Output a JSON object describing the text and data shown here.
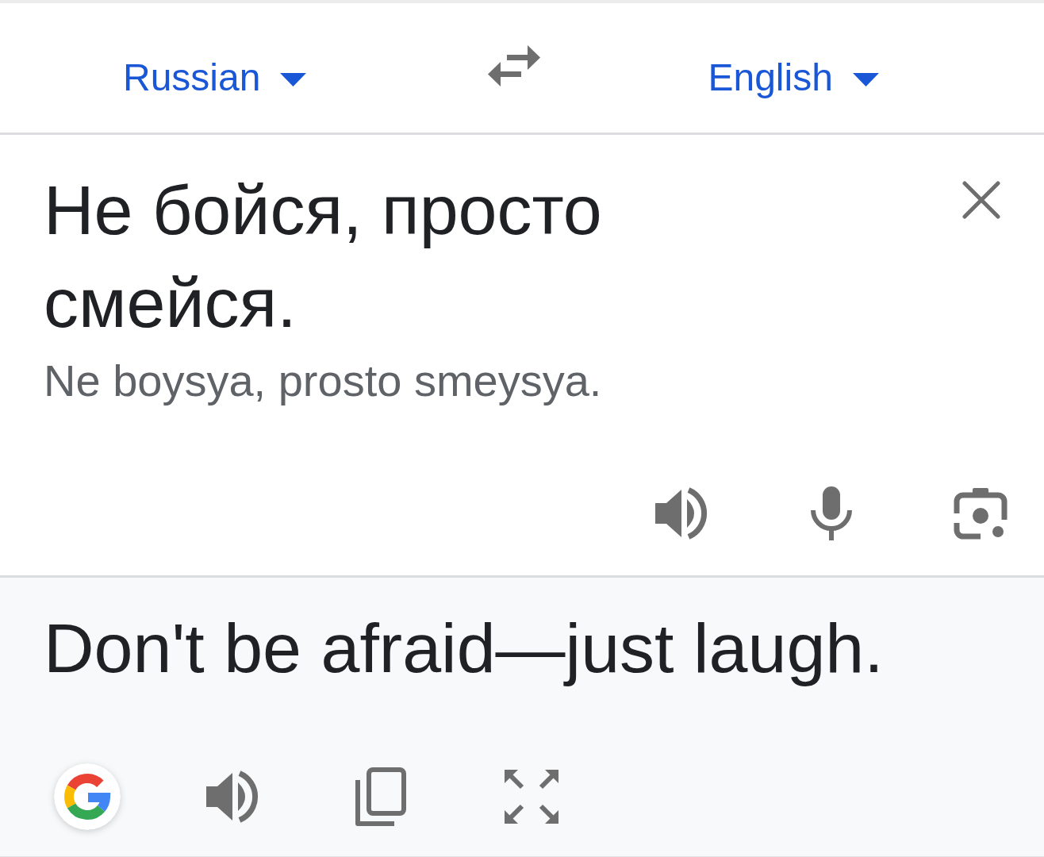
{
  "languages": {
    "source": {
      "label": "Russian"
    },
    "target": {
      "label": "English"
    }
  },
  "source": {
    "text": "Не бойся, просто смейся.",
    "transliteration": "Ne boysya, prosto smeysya."
  },
  "translation": {
    "text": "Don't be afraid—just laugh."
  }
}
